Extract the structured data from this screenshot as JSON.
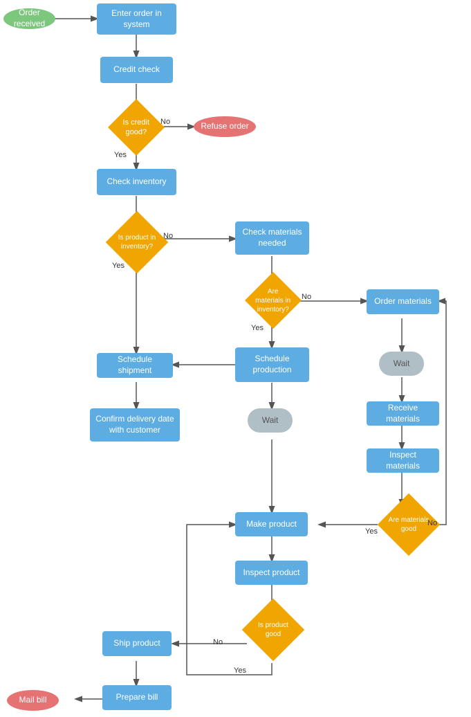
{
  "nodes": {
    "order_received": {
      "label": "Order received"
    },
    "enter_order": {
      "label": "Enter order in system"
    },
    "credit_check": {
      "label": "Credit check"
    },
    "is_credit_good": {
      "label": "Is credit good?"
    },
    "refuse_order": {
      "label": "Refuse order"
    },
    "check_inventory": {
      "label": "Check inventory"
    },
    "is_product_in_inventory": {
      "label": "Is product in inventory?"
    },
    "check_materials_needed": {
      "label": "Check materials needed"
    },
    "are_materials_in_inventory": {
      "label": "Are materials in inventory?"
    },
    "order_materials": {
      "label": "Order materials"
    },
    "wait1": {
      "label": "Wait"
    },
    "receive_materials": {
      "label": "Receive materials"
    },
    "inspect_materials": {
      "label": "Inspect materials"
    },
    "are_materials_good": {
      "label": "Are materials good"
    },
    "schedule_production": {
      "label": "Schedule production"
    },
    "wait2": {
      "label": "Wait"
    },
    "schedule_shipment": {
      "label": "Schedule shipment"
    },
    "confirm_delivery": {
      "label": "Confirm delivery date with customer"
    },
    "make_product": {
      "label": "Make product"
    },
    "inspect_product": {
      "label": "Inspect product"
    },
    "is_product_good": {
      "label": "Is product good"
    },
    "ship_product": {
      "label": "Ship product"
    },
    "prepare_bill": {
      "label": "Prepare bill"
    },
    "mail_bill": {
      "label": "Mail bill"
    }
  },
  "labels": {
    "no": "No",
    "yes": "Yes"
  }
}
